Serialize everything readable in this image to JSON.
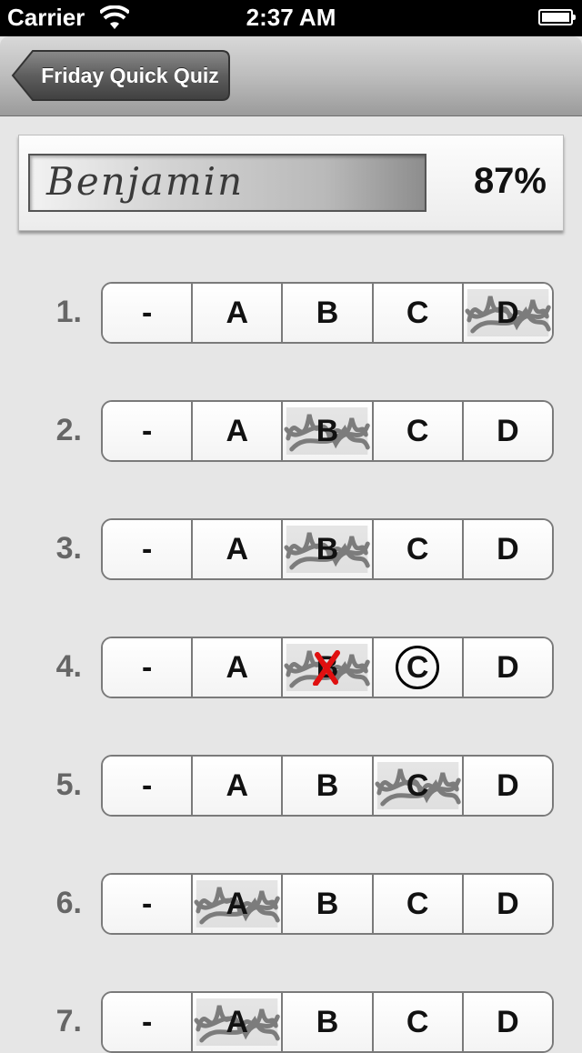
{
  "status_bar": {
    "carrier": "Carrier",
    "time": "2:37 AM"
  },
  "nav": {
    "back_label": "Friday Quick Quiz"
  },
  "student": {
    "name": "Benjamin",
    "score": "87%"
  },
  "option_labels": [
    "-",
    "A",
    "B",
    "C",
    "D"
  ],
  "questions": [
    {
      "number": "1.",
      "marked": "D",
      "wrong": null,
      "correct": null
    },
    {
      "number": "2.",
      "marked": "B",
      "wrong": null,
      "correct": null
    },
    {
      "number": "3.",
      "marked": "B",
      "wrong": null,
      "correct": null
    },
    {
      "number": "4.",
      "marked": "B",
      "wrong": "B",
      "correct": "C"
    },
    {
      "number": "5.",
      "marked": "C",
      "wrong": null,
      "correct": null
    },
    {
      "number": "6.",
      "marked": "A",
      "wrong": null,
      "correct": null
    },
    {
      "number": "7.",
      "marked": "A",
      "wrong": null,
      "correct": null
    }
  ],
  "colors": {
    "wrong_mark": "#e01010",
    "scribble": "#6a6a6a"
  }
}
